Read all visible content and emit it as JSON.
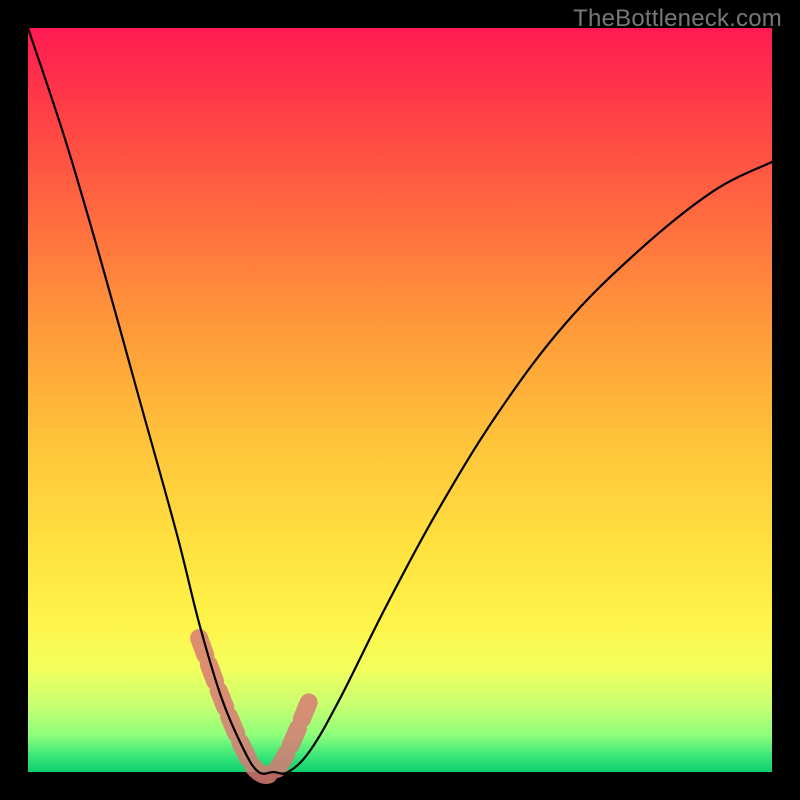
{
  "watermark": "TheBottleneck.com",
  "chart_data": {
    "type": "line",
    "title": "",
    "xlabel": "",
    "ylabel": "",
    "xlim": [
      0,
      100
    ],
    "ylim": [
      0,
      100
    ],
    "grid": false,
    "legend": false,
    "background_gradient": {
      "stops": [
        {
          "pos": 0,
          "color": "#ff1a52"
        },
        {
          "pos": 25,
          "color": "#ff6a3f"
        },
        {
          "pos": 55,
          "color": "#ffc23a"
        },
        {
          "pos": 80,
          "color": "#fff44a"
        },
        {
          "pos": 95,
          "color": "#8fff7a"
        },
        {
          "pos": 100,
          "color": "#0ecf6d"
        }
      ]
    },
    "series": [
      {
        "name": "bottleneck-curve",
        "x": [
          0,
          5,
          10,
          15,
          20,
          23,
          26,
          29,
          31,
          33,
          35,
          38,
          42,
          48,
          55,
          63,
          72,
          82,
          92,
          100
        ],
        "values": [
          100,
          85,
          68,
          50,
          32,
          20,
          10,
          3,
          0,
          0,
          0,
          3,
          10,
          22,
          35,
          48,
          60,
          70,
          78,
          82
        ]
      }
    ],
    "annotations": [
      {
        "name": "valley-highlight",
        "color": "#d87a74",
        "style": "thick-dashed",
        "x": [
          23,
          26,
          29,
          31,
          33,
          35,
          38
        ],
        "values": [
          18,
          10,
          3,
          0,
          0,
          3,
          10
        ]
      }
    ]
  }
}
